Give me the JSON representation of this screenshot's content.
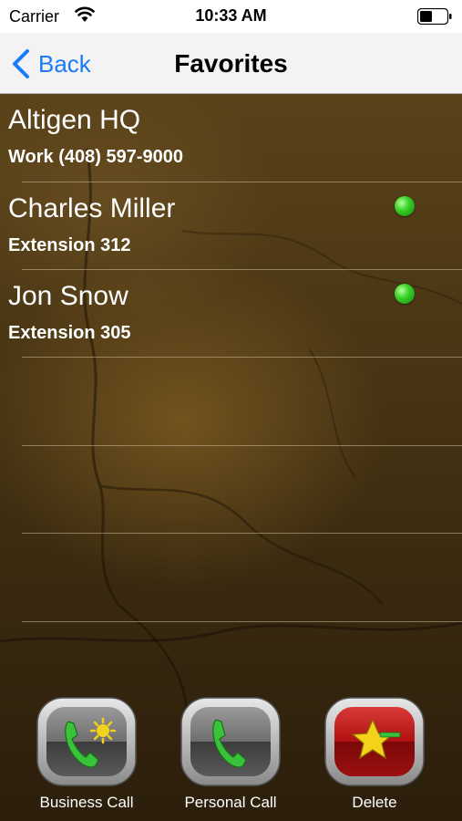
{
  "status_bar": {
    "carrier": "Carrier",
    "time": "10:33 AM"
  },
  "nav": {
    "back_label": "Back",
    "title": "Favorites"
  },
  "favorites": [
    {
      "name": "Altigen HQ",
      "detail": "Work (408) 597-9000",
      "online": false
    },
    {
      "name": "Charles Miller",
      "detail": "Extension 312",
      "online": true
    },
    {
      "name": "Jon Snow",
      "detail": "Extension 305",
      "online": true
    }
  ],
  "actions": {
    "business_call": "Business Call",
    "personal_call": "Personal Call",
    "delete": "Delete"
  },
  "colors": {
    "accent": "#1a7cf5",
    "presence_online": "#39d12a",
    "phone_green": "#39c23a",
    "delete_red": "#b01010",
    "star_yellow": "#f2d21a"
  },
  "icons": {
    "business_call": "phone-with-sun-icon",
    "personal_call": "phone-icon",
    "delete": "star-icon"
  }
}
